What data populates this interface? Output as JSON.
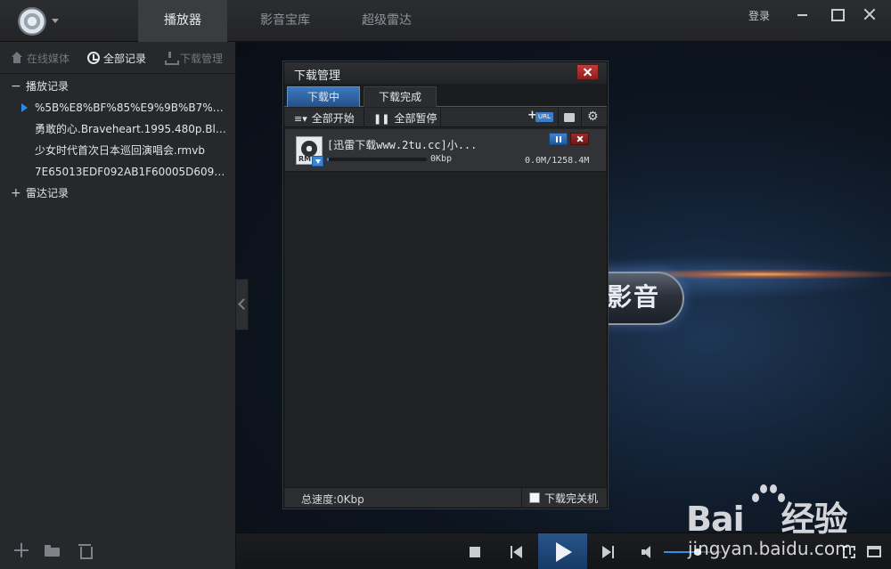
{
  "header": {
    "tabs": [
      {
        "label": "播放器",
        "active": true
      },
      {
        "label": "影音宝库",
        "active": false
      },
      {
        "label": "超级雷达",
        "active": false
      }
    ],
    "login_label": "登录"
  },
  "sidebar": {
    "tabs": [
      {
        "label": "在线媒体",
        "icon": "home-icon",
        "active": false
      },
      {
        "label": "全部记录",
        "icon": "clock-icon",
        "active": true
      },
      {
        "label": "下载管理",
        "icon": "download-icon",
        "active": false
      }
    ],
    "groups": [
      {
        "toggle": "−",
        "label": "播放记录",
        "items": [
          {
            "label": "%5B%E8%BF%85%E9%9B%B7%E4...",
            "playing": true
          },
          {
            "label": "勇敢的心.Braveheart.1995.480p.Blur...",
            "playing": false
          },
          {
            "label": "少女时代首次日本巡回演唱会.rmvb",
            "playing": false
          },
          {
            "label": "7E65013EDF092AB1F60005D609F0...",
            "playing": false
          }
        ]
      },
      {
        "toggle": "+",
        "label": "雷达记录",
        "items": []
      }
    ],
    "bottom_icons": [
      "add-icon",
      "folder-icon",
      "trash-icon"
    ]
  },
  "main": {
    "brand_text": "影音"
  },
  "controls": {
    "volume_level": 0.58,
    "accent": "#2f8ee6"
  },
  "dialog": {
    "title": "下载管理",
    "tabs": [
      {
        "label": "下载中",
        "active": true
      },
      {
        "label": "下载完成",
        "active": false
      }
    ],
    "toolbar": {
      "start_all_label": "全部开始",
      "pause_all_label": "全部暂停",
      "url_tag": "URL"
    },
    "items": [
      {
        "name": "[迅雷下载www.2tu.cc]小...",
        "thumb_label": "RM",
        "speed": "0Kbp",
        "size": "0.0M/1258.4M",
        "progress": 0.02
      }
    ],
    "status": {
      "total_speed": "总速度:0Kbp",
      "shutdown_label": "下载完关机",
      "shutdown_checked": false
    }
  },
  "watermark": {
    "brand": "Bai",
    "brand_tail": "经验",
    "url": "jingyan.baidu.com"
  }
}
